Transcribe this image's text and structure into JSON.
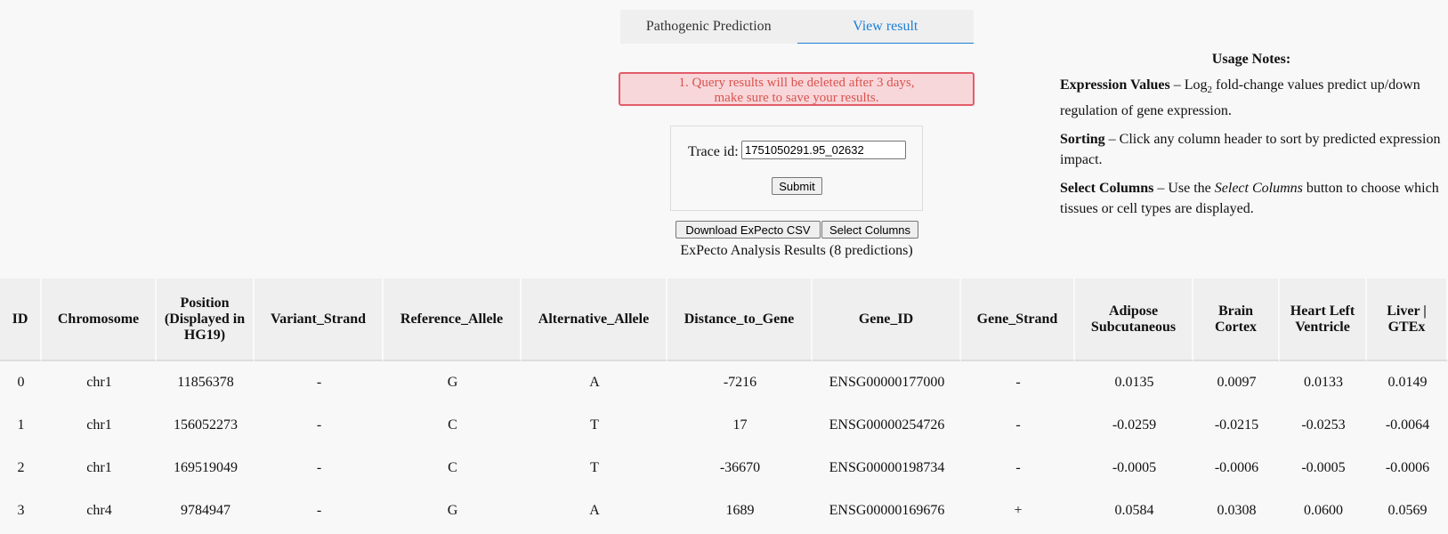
{
  "tabs": [
    {
      "label": "Pathogenic Prediction",
      "active": false
    },
    {
      "label": "View result",
      "active": true
    }
  ],
  "alert": {
    "line1": "1. Query results will be deleted after 3 days,",
    "line2": "make sure to save your results."
  },
  "trace": {
    "label": "Trace id:",
    "value": "1751050291.95_02632",
    "submit_label": "Submit"
  },
  "actions": {
    "download_label": "Download ExPecto CSV",
    "select_columns_label": "Select Columns"
  },
  "results_caption": "ExPecto Analysis Results (8 predictions)",
  "notes": {
    "title": "Usage Notes:",
    "expression": {
      "term": "Expression Values",
      "dash": " – Log",
      "sub": "2",
      "text": " fold-change values predict up/down regulation of gene expression."
    },
    "sorting": {
      "term": "Sorting",
      "text": " – Click any column header to sort by predicted expression impact."
    },
    "select_columns": {
      "term": "Select Columns",
      "text_before": " – Use the ",
      "emphasis": "Select Columns",
      "text_after": " button to choose which tissues or cell types are displayed."
    }
  },
  "table": {
    "headers": [
      "ID",
      "Chromosome",
      "Position (Displayed in HG19)",
      "Variant_Strand",
      "Reference_Allele",
      "Alternative_Allele",
      "Distance_to_Gene",
      "Gene_ID",
      "Gene_Strand",
      "Adipose Subcutaneous",
      "Brain Cortex",
      "Heart Left Ventricle",
      "Liver | GTEx"
    ],
    "rows": [
      [
        "0",
        "chr1",
        "11856378",
        "-",
        "G",
        "A",
        "-7216",
        "ENSG00000177000",
        "-",
        "0.0135",
        "0.0097",
        "0.0133",
        "0.0149"
      ],
      [
        "1",
        "chr1",
        "156052273",
        "-",
        "C",
        "T",
        "17",
        "ENSG00000254726",
        "-",
        "-0.0259",
        "-0.0215",
        "-0.0253",
        "-0.0064"
      ],
      [
        "2",
        "chr1",
        "169519049",
        "-",
        "C",
        "T",
        "-36670",
        "ENSG00000198734",
        "-",
        "-0.0005",
        "-0.0006",
        "-0.0005",
        "-0.0006"
      ],
      [
        "3",
        "chr4",
        "9784947",
        "-",
        "G",
        "A",
        "1689",
        "ENSG00000169676",
        "+",
        "0.0584",
        "0.0308",
        "0.0600",
        "0.0569"
      ]
    ]
  }
}
